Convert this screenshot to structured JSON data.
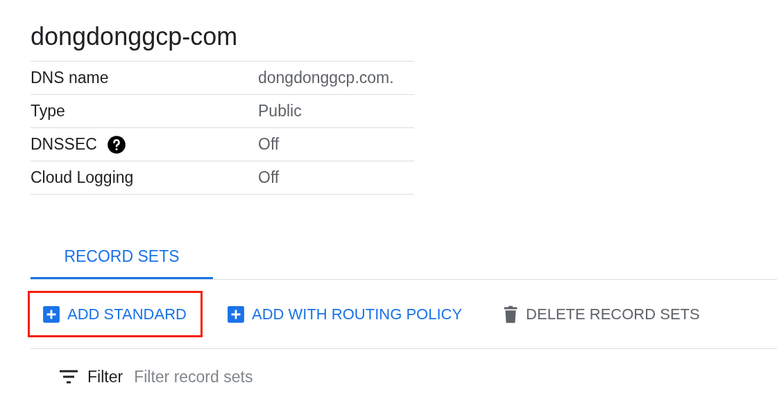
{
  "title": "dongdonggcp-com",
  "details": [
    {
      "label": "DNS name",
      "value": "dongdonggcp.com.",
      "help": false
    },
    {
      "label": "Type",
      "value": "Public",
      "help": false
    },
    {
      "label": "DNSSEC",
      "value": "Off",
      "help": true
    },
    {
      "label": "Cloud Logging",
      "value": "Off",
      "help": false
    }
  ],
  "tabs": [
    {
      "label": "RECORD SETS",
      "selected": true
    }
  ],
  "actions": [
    {
      "label": "ADD STANDARD",
      "kind": "add",
      "disabled": false,
      "highlighted": true
    },
    {
      "label": "ADD WITH ROUTING POLICY",
      "kind": "add",
      "disabled": false,
      "highlighted": false
    },
    {
      "label": "DELETE RECORD SETS",
      "kind": "delete",
      "disabled": true,
      "highlighted": false
    }
  ],
  "filter": {
    "label": "Filter",
    "placeholder": "Filter record sets"
  }
}
